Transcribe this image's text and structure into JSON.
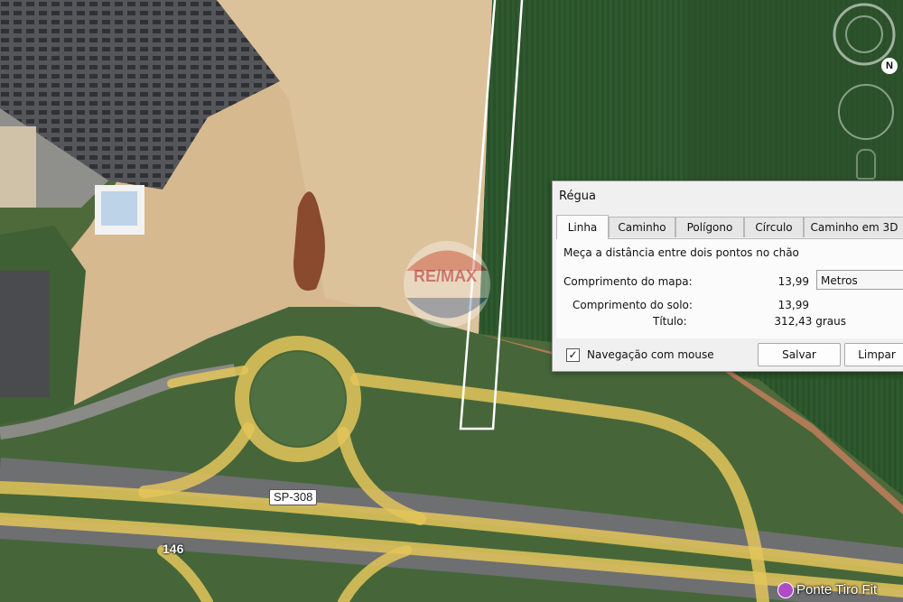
{
  "map": {
    "road_labels": {
      "sp308": "SP-308",
      "r146": "146",
      "partial_place": "Ponte Tiro Fit"
    },
    "watermark_text": "RE/MAX",
    "compass_letter": "N"
  },
  "ruler_dialog": {
    "title": "Régua",
    "tabs": [
      "Linha",
      "Caminho",
      "Polígono",
      "Círculo",
      "Caminho em 3D"
    ],
    "active_tab": "Linha",
    "description": "Meça a distância entre dois pontos no chão",
    "map_length_label": "Comprimento do mapa:",
    "map_length_value": "13,99",
    "unit_selected": "Metros",
    "ground_length_label": "Comprimento do solo:",
    "ground_length_value": "13,99",
    "heading_label": "Título:",
    "heading_value": "312,43 graus",
    "mouse_nav_label": "Navegação com mouse",
    "mouse_nav_checked": true,
    "save_button": "Salvar",
    "clear_button": "Limpar"
  }
}
